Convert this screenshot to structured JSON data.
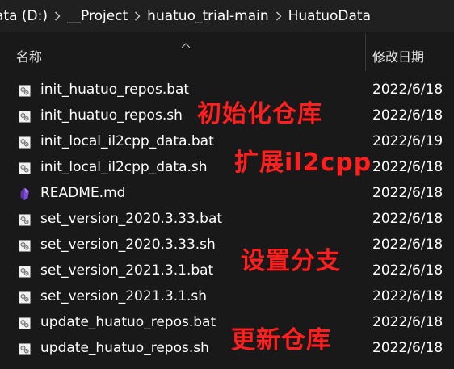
{
  "breadcrumb": [
    {
      "label": "ata (D:)"
    },
    {
      "label": "__Project"
    },
    {
      "label": "huatuo_trial-main"
    },
    {
      "label": "HuatuoData"
    }
  ],
  "columns": {
    "name": "名称",
    "date": "修改日期",
    "sort": "ascending"
  },
  "files": [
    {
      "name": "init_huatuo_repos.bat",
      "date": "2022/6/18",
      "icon": "script-file-icon"
    },
    {
      "name": "init_huatuo_repos.sh",
      "date": "2022/6/18",
      "icon": "script-file-icon"
    },
    {
      "name": "init_local_il2cpp_data.bat",
      "date": "2022/6/19",
      "icon": "script-file-icon"
    },
    {
      "name": "init_local_il2cpp_data.sh",
      "date": "2022/6/18",
      "icon": "script-file-icon"
    },
    {
      "name": "README.md",
      "date": "2022/6/18",
      "icon": "markdown-crystal-icon"
    },
    {
      "name": "set_version_2020.3.33.bat",
      "date": "2022/6/18",
      "icon": "script-file-icon"
    },
    {
      "name": "set_version_2020.3.33.sh",
      "date": "2022/6/18",
      "icon": "script-file-icon"
    },
    {
      "name": "set_version_2021.3.1.bat",
      "date": "2022/6/18",
      "icon": "script-file-icon"
    },
    {
      "name": "set_version_2021.3.1.sh",
      "date": "2022/6/18",
      "icon": "script-file-icon"
    },
    {
      "name": "update_huatuo_repos.bat",
      "date": "2022/6/18",
      "icon": "script-file-icon"
    },
    {
      "name": "update_huatuo_repos.sh",
      "date": "2022/6/18",
      "icon": "script-file-icon"
    }
  ],
  "annotations": [
    "初始化仓库",
    "扩展il2cpp",
    "设置分支",
    "更新仓库"
  ],
  "colors": {
    "background": "#191919",
    "breadcrumb_bg": "#202020",
    "text": "#ffffff",
    "annotation": "#ff1f1f",
    "readme_icon": "#7b4fd0"
  }
}
